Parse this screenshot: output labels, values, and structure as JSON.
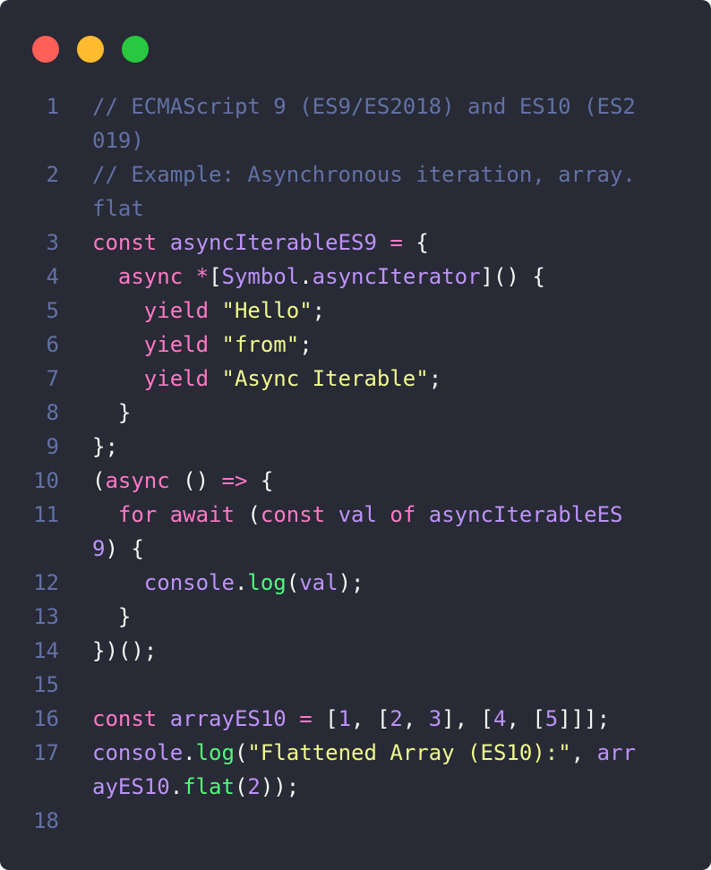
{
  "window": {
    "traffic_lights": [
      {
        "name": "close",
        "color": "#ff5f57"
      },
      {
        "name": "minimize",
        "color": "#febc2e"
      },
      {
        "name": "zoom",
        "color": "#28c840"
      }
    ]
  },
  "colors": {
    "background": "#282a36",
    "comment": "#6272a4",
    "keyword": "#ff79c6",
    "variable": "#bd93f9",
    "string": "#f1fa8c",
    "function": "#50fa7b",
    "plain": "#f8f8f2"
  },
  "code": {
    "rows": [
      {
        "ln": "1",
        "t": [
          {
            "c": "c",
            "x": "// ECMAScript 9 (ES9/ES2018) and ES10 (ES2"
          }
        ]
      },
      {
        "ln": "",
        "t": [
          {
            "c": "c",
            "x": "019)"
          }
        ]
      },
      {
        "ln": "2",
        "t": [
          {
            "c": "c",
            "x": "// Example: Asynchronous iteration, array."
          }
        ]
      },
      {
        "ln": "",
        "t": [
          {
            "c": "c",
            "x": "flat"
          }
        ]
      },
      {
        "ln": "3",
        "t": [
          {
            "c": "k",
            "x": "const "
          },
          {
            "c": "v",
            "x": "asyncIterableES9"
          },
          {
            "c": "p",
            "x": " "
          },
          {
            "c": "k",
            "x": "="
          },
          {
            "c": "p",
            "x": " {"
          }
        ]
      },
      {
        "ln": "4",
        "t": [
          {
            "c": "p",
            "x": "  "
          },
          {
            "c": "k",
            "x": "async"
          },
          {
            "c": "p",
            "x": " "
          },
          {
            "c": "k",
            "x": "*"
          },
          {
            "c": "p",
            "x": "["
          },
          {
            "c": "v",
            "x": "Symbol"
          },
          {
            "c": "p",
            "x": "."
          },
          {
            "c": "v",
            "x": "asyncIterator"
          },
          {
            "c": "p",
            "x": "]() {"
          }
        ]
      },
      {
        "ln": "5",
        "t": [
          {
            "c": "p",
            "x": "    "
          },
          {
            "c": "k",
            "x": "yield"
          },
          {
            "c": "p",
            "x": " "
          },
          {
            "c": "s",
            "x": "\"Hello\""
          },
          {
            "c": "p",
            "x": ";"
          }
        ]
      },
      {
        "ln": "6",
        "t": [
          {
            "c": "p",
            "x": "    "
          },
          {
            "c": "k",
            "x": "yield"
          },
          {
            "c": "p",
            "x": " "
          },
          {
            "c": "s",
            "x": "\"from\""
          },
          {
            "c": "p",
            "x": ";"
          }
        ]
      },
      {
        "ln": "7",
        "t": [
          {
            "c": "p",
            "x": "    "
          },
          {
            "c": "k",
            "x": "yield"
          },
          {
            "c": "p",
            "x": " "
          },
          {
            "c": "s",
            "x": "\"Async Iterable\""
          },
          {
            "c": "p",
            "x": ";"
          }
        ]
      },
      {
        "ln": "8",
        "t": [
          {
            "c": "p",
            "x": "  }"
          }
        ]
      },
      {
        "ln": "9",
        "t": [
          {
            "c": "p",
            "x": "};"
          }
        ]
      },
      {
        "ln": "10",
        "t": [
          {
            "c": "p",
            "x": "("
          },
          {
            "c": "k",
            "x": "async"
          },
          {
            "c": "p",
            "x": " () "
          },
          {
            "c": "k",
            "x": "=>"
          },
          {
            "c": "p",
            "x": " {"
          }
        ]
      },
      {
        "ln": "11",
        "t": [
          {
            "c": "p",
            "x": "  "
          },
          {
            "c": "k",
            "x": "for"
          },
          {
            "c": "p",
            "x": " "
          },
          {
            "c": "k",
            "x": "await"
          },
          {
            "c": "p",
            "x": " ("
          },
          {
            "c": "k",
            "x": "const"
          },
          {
            "c": "p",
            "x": " "
          },
          {
            "c": "v",
            "x": "val"
          },
          {
            "c": "p",
            "x": " "
          },
          {
            "c": "k",
            "x": "of"
          },
          {
            "c": "p",
            "x": " "
          },
          {
            "c": "v",
            "x": "asyncIterableES"
          }
        ]
      },
      {
        "ln": "",
        "t": [
          {
            "c": "v",
            "x": "9"
          },
          {
            "c": "p",
            "x": ") {"
          }
        ]
      },
      {
        "ln": "12",
        "t": [
          {
            "c": "p",
            "x": "    "
          },
          {
            "c": "v",
            "x": "console"
          },
          {
            "c": "p",
            "x": "."
          },
          {
            "c": "f",
            "x": "log"
          },
          {
            "c": "p",
            "x": "("
          },
          {
            "c": "v",
            "x": "val"
          },
          {
            "c": "p",
            "x": ");"
          }
        ]
      },
      {
        "ln": "13",
        "t": [
          {
            "c": "p",
            "x": "  }"
          }
        ]
      },
      {
        "ln": "14",
        "t": [
          {
            "c": "p",
            "x": "})();"
          }
        ]
      },
      {
        "ln": "15",
        "t": []
      },
      {
        "ln": "16",
        "t": [
          {
            "c": "k",
            "x": "const"
          },
          {
            "c": "p",
            "x": " "
          },
          {
            "c": "v",
            "x": "arrayES10"
          },
          {
            "c": "p",
            "x": " "
          },
          {
            "c": "k",
            "x": "="
          },
          {
            "c": "p",
            "x": " ["
          },
          {
            "c": "v",
            "x": "1"
          },
          {
            "c": "p",
            "x": ", ["
          },
          {
            "c": "v",
            "x": "2"
          },
          {
            "c": "p",
            "x": ", "
          },
          {
            "c": "v",
            "x": "3"
          },
          {
            "c": "p",
            "x": "], ["
          },
          {
            "c": "v",
            "x": "4"
          },
          {
            "c": "p",
            "x": ", ["
          },
          {
            "c": "v",
            "x": "5"
          },
          {
            "c": "p",
            "x": "]]];"
          }
        ]
      },
      {
        "ln": "17",
        "t": [
          {
            "c": "v",
            "x": "console"
          },
          {
            "c": "p",
            "x": "."
          },
          {
            "c": "f",
            "x": "log"
          },
          {
            "c": "p",
            "x": "("
          },
          {
            "c": "s",
            "x": "\"Flattened Array (ES10):\""
          },
          {
            "c": "p",
            "x": ", "
          },
          {
            "c": "v",
            "x": "arr"
          }
        ]
      },
      {
        "ln": "",
        "t": [
          {
            "c": "v",
            "x": "ayES10"
          },
          {
            "c": "p",
            "x": "."
          },
          {
            "c": "f",
            "x": "flat"
          },
          {
            "c": "p",
            "x": "("
          },
          {
            "c": "v",
            "x": "2"
          },
          {
            "c": "p",
            "x": "));"
          }
        ]
      },
      {
        "ln": "18",
        "t": []
      }
    ]
  }
}
